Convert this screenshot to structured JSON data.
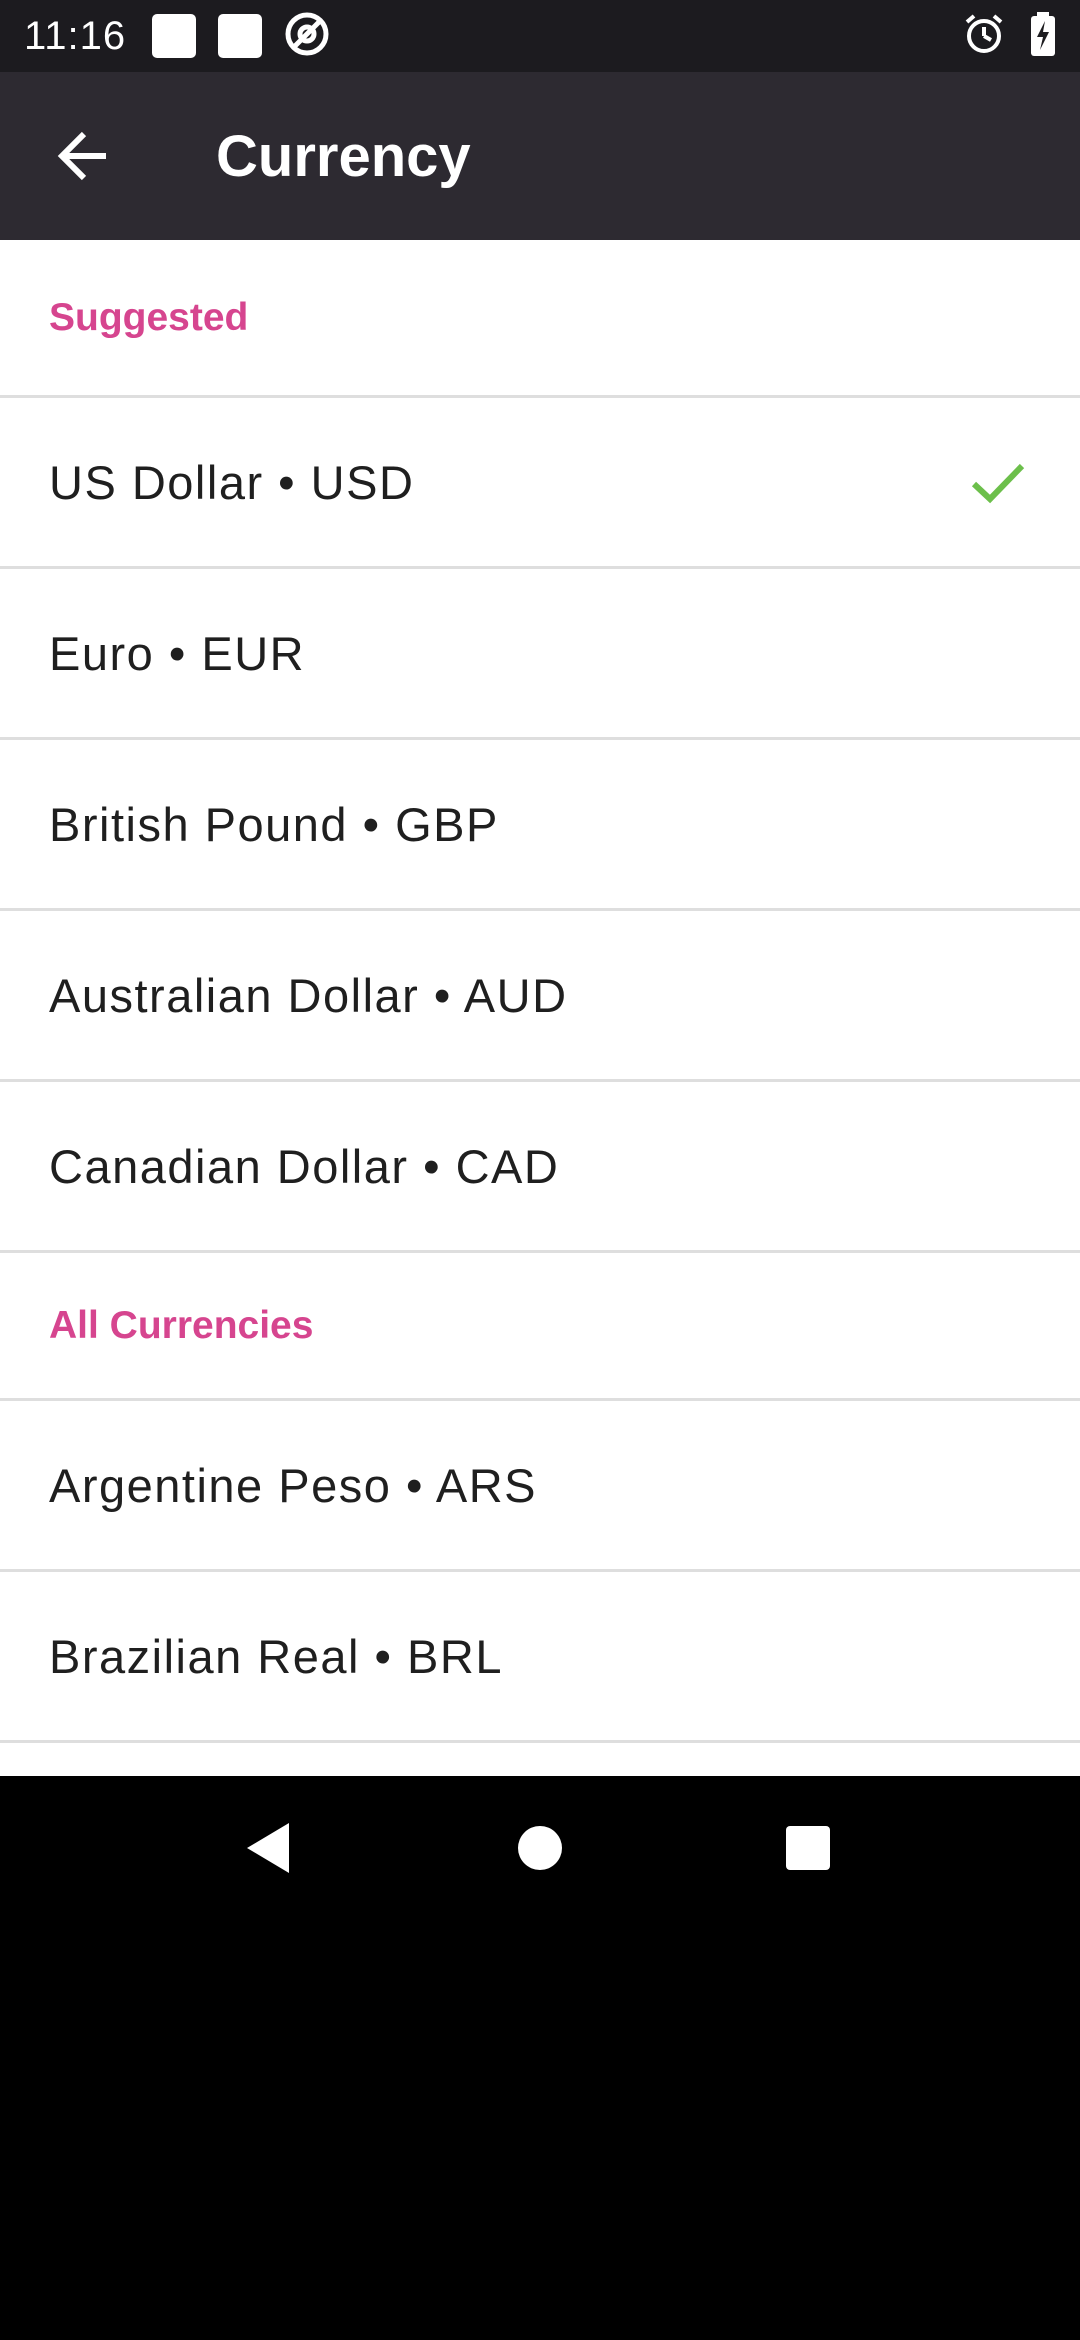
{
  "status_bar": {
    "time": "11:16",
    "icons": [
      "notification-square-icon",
      "notification-square-icon",
      "at-sign-icon",
      "alarm-icon",
      "battery-charging-icon"
    ]
  },
  "app_bar": {
    "title": "Currency",
    "back_icon": "arrow-left-icon"
  },
  "colors": {
    "accent": "#d6458f",
    "check": "#6cbf4b",
    "app_bar_bg": "#2d2a31",
    "status_bar_bg": "#1c1b1f"
  },
  "sections": {
    "suggested": {
      "title": "Suggested",
      "items": [
        {
          "label": "US Dollar • USD",
          "selected": true
        },
        {
          "label": "Euro • EUR",
          "selected": false
        },
        {
          "label": "British Pound • GBP",
          "selected": false
        },
        {
          "label": "Australian Dollar • AUD",
          "selected": false
        },
        {
          "label": "Canadian Dollar • CAD",
          "selected": false
        }
      ]
    },
    "all": {
      "title": "All Currencies",
      "items": [
        {
          "label": "Argentine Peso • ARS",
          "selected": false
        },
        {
          "label": "Brazilian Real • BRL",
          "selected": false
        }
      ]
    }
  },
  "nav_bar": {
    "icons": [
      "nav-back-icon",
      "nav-home-icon",
      "nav-recents-icon"
    ]
  }
}
